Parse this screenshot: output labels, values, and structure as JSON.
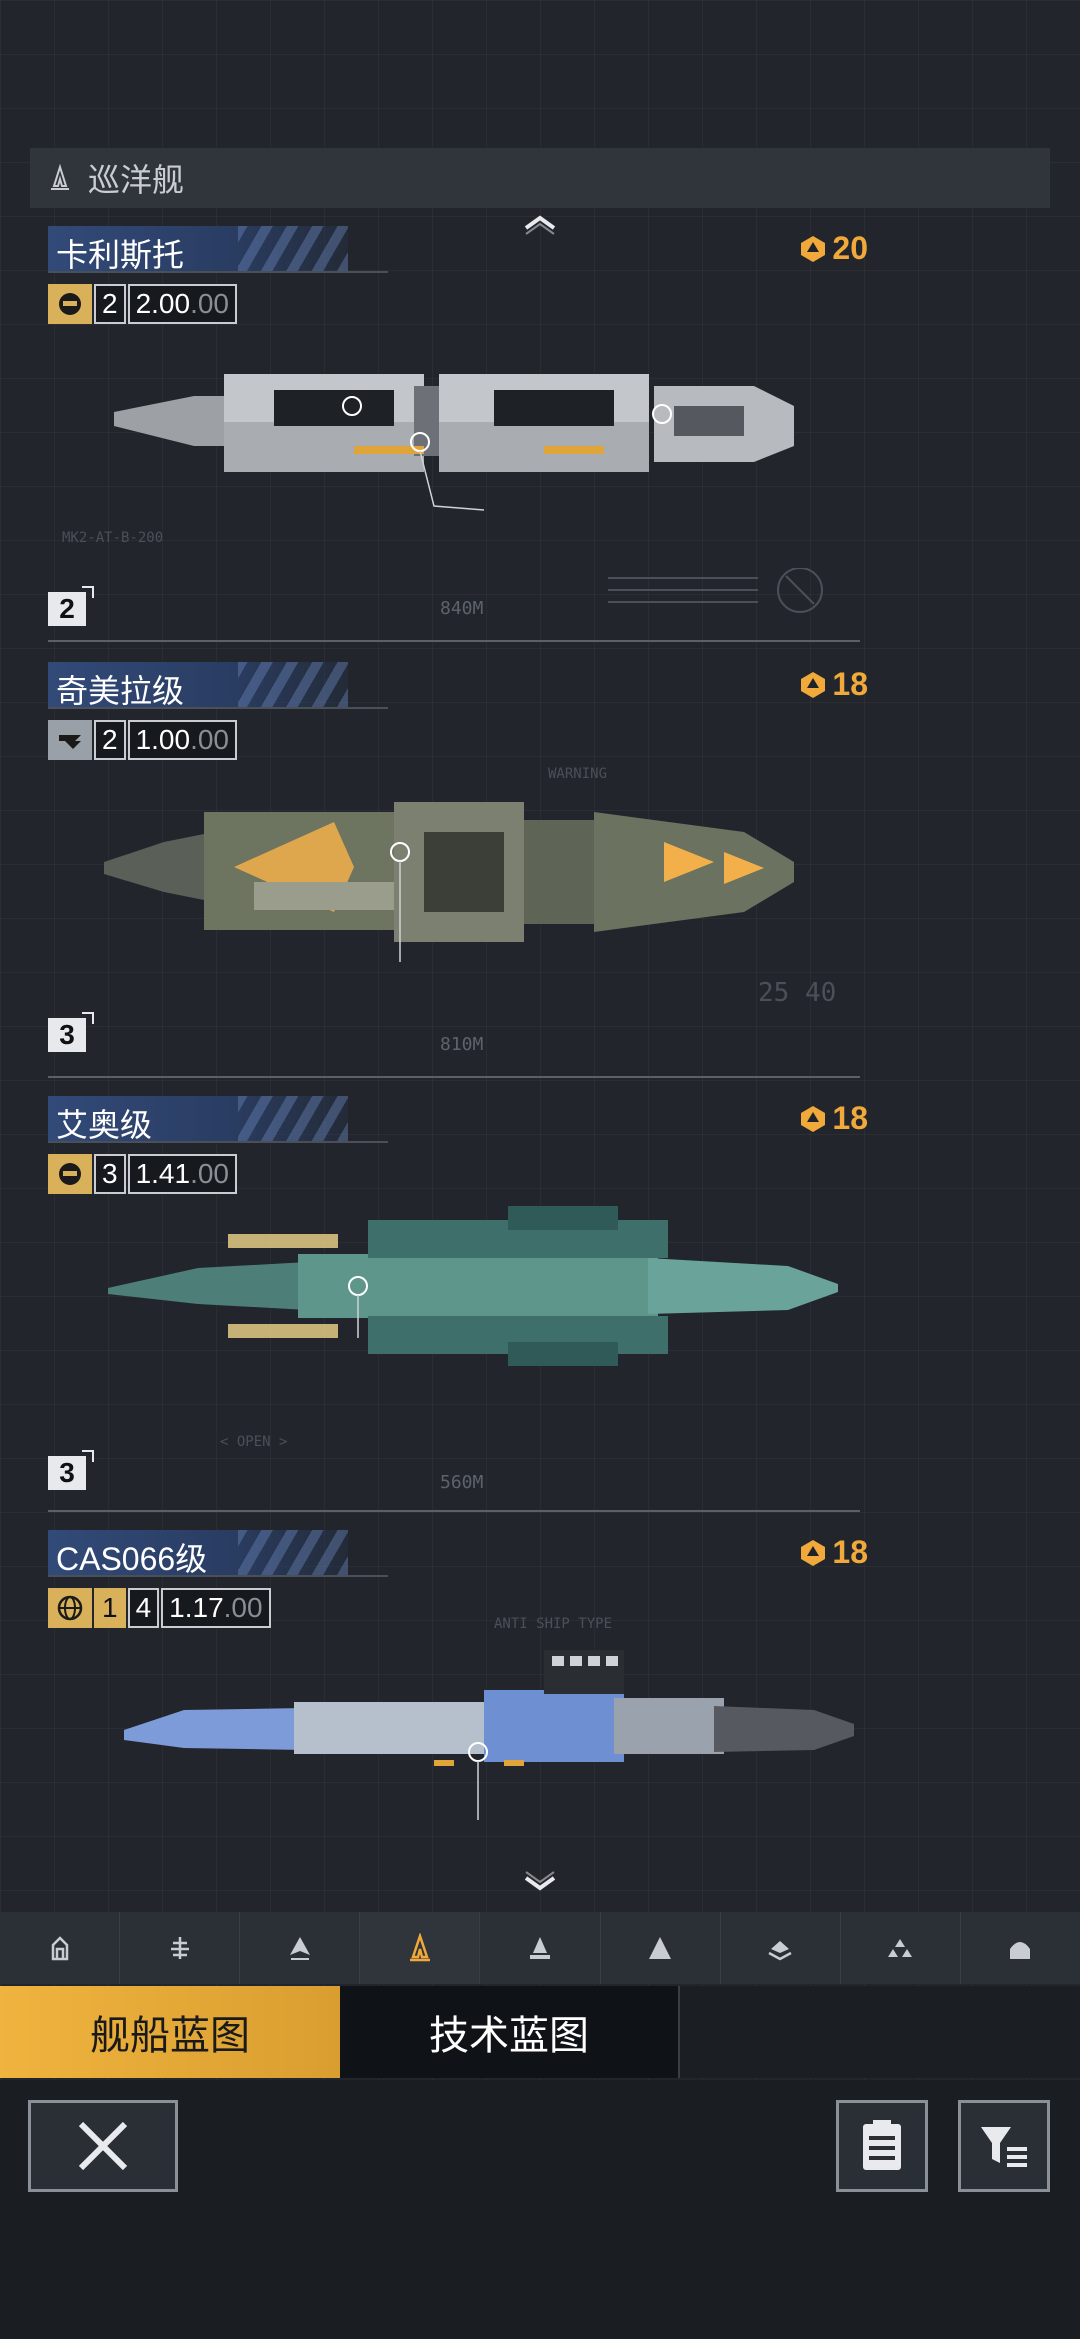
{
  "section": {
    "title": "巡洋舰",
    "icon": "cruiser-class-icon"
  },
  "ships": [
    {
      "name": "卡利斯托",
      "cost": "20",
      "faction_icon": "helmet-faction-icon",
      "stat_level": "2",
      "stat_value": "2.00",
      "stat_suffix": ".00",
      "tier": "2",
      "scale_label": "840M",
      "deco_text": "MK2-AT-B-200",
      "colors": {
        "hull": "#b9bdc2",
        "accent": "#e0a53a"
      }
    },
    {
      "name": "奇美拉级",
      "cost": "18",
      "faction_icon": "wing-faction-icon",
      "stat_level": "2",
      "stat_value": "1.00",
      "stat_suffix": ".00",
      "tier": "3",
      "scale_label": "810M",
      "deco_text": "WARNING",
      "deco_num": "25 40",
      "colors": {
        "hull": "#6b7360",
        "accent": "#f3b04a"
      }
    },
    {
      "name": "艾奥级",
      "cost": "18",
      "faction_icon": "helmet-faction-icon",
      "stat_level": "3",
      "stat_value": "1.41",
      "stat_suffix": ".00",
      "tier": "3",
      "scale_label": "560M",
      "deco_text": "< OPEN >",
      "colors": {
        "hull": "#4d8a80",
        "accent": "#f0d58a"
      }
    },
    {
      "name": "CAS066级",
      "cost": "18",
      "faction_icon": "globe-faction-icon",
      "stat_level_a": "1",
      "stat_level": "4",
      "stat_value": "1.17",
      "stat_suffix": ".00",
      "deco_text": "ANTI SHIP TYPE",
      "colors": {
        "hull": "#7d9bd8",
        "accent": "#e0a53a"
      }
    }
  ],
  "class_tabs": [
    {
      "icon": "frigate-icon",
      "active": false
    },
    {
      "icon": "destroyer-icon",
      "active": false
    },
    {
      "icon": "corvette-icon",
      "active": false
    },
    {
      "icon": "cruiser-icon",
      "active": true
    },
    {
      "icon": "battlecruiser-icon",
      "active": false
    },
    {
      "icon": "battleship-icon",
      "active": false
    },
    {
      "icon": "carrier-icon",
      "active": false
    },
    {
      "icon": "fleet-icon",
      "active": false
    },
    {
      "icon": "station-icon",
      "active": false
    }
  ],
  "blueprint_tabs": {
    "ship": "舰船蓝图",
    "tech": "技术蓝图",
    "active": "ship"
  },
  "bottom": {
    "close_icon": "close-icon",
    "list_icon": "clipboard-icon",
    "filter_icon": "filter-icon"
  },
  "colors": {
    "accent": "#f0a93a",
    "active_tab": "#f0b33e",
    "background": "#22262c"
  }
}
